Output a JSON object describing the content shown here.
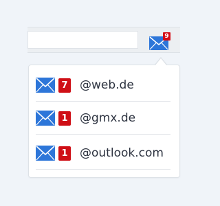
{
  "colors": {
    "background": "#f0f4f9",
    "accent_blue": "#2d76d9",
    "badge_red": "#d50d15"
  },
  "toolbar": {
    "mail_icon": "envelope-icon",
    "unread_total": "9"
  },
  "popup": {
    "accounts": [
      {
        "icon": "envelope-icon",
        "unread": "7",
        "label": "@web.de"
      },
      {
        "icon": "envelope-icon",
        "unread": "1",
        "label": "@gmx.de"
      },
      {
        "icon": "envelope-icon",
        "unread": "1",
        "label": "@outlook.com"
      }
    ]
  }
}
